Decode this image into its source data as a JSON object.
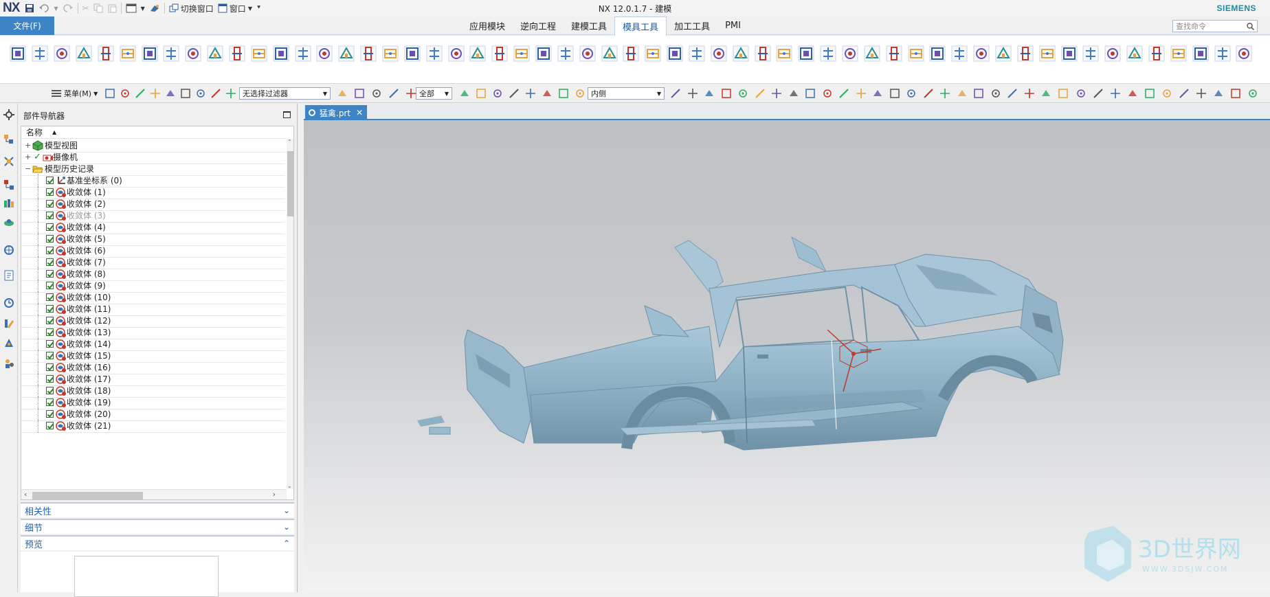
{
  "app": {
    "title": "NX 12.0.1.7 - 建模",
    "logo": "NX",
    "vendor": "SIEMENS"
  },
  "quickaccess": {
    "switch_window": "切换窗口",
    "window": "窗口"
  },
  "menubar": {
    "file": "文件(F)",
    "tabs": [
      "应用模块",
      "逆向工程",
      "建模工具",
      "模具工具",
      "加工工具",
      "PMI"
    ],
    "active_tab": "模具工具",
    "search_placeholder": "查找命令"
  },
  "selection_bar": {
    "menu": "菜单(M)",
    "filter": "无选择过滤器",
    "scope": "全部",
    "inside": "内侧"
  },
  "navigator": {
    "title": "部件导航器",
    "column_name": "名称",
    "top_nodes": [
      {
        "label": "模型视图"
      },
      {
        "label": "摄像机"
      },
      {
        "label": "模型历史记录"
      }
    ],
    "history": [
      {
        "label": "基准坐标系 (0)",
        "dim": false
      },
      {
        "label": "收敛体 (1)",
        "dim": false
      },
      {
        "label": "收敛体 (2)",
        "dim": false
      },
      {
        "label": "收敛体 (3)",
        "dim": true
      },
      {
        "label": "收敛体 (4)",
        "dim": false
      },
      {
        "label": "收敛体 (5)",
        "dim": false
      },
      {
        "label": "收敛体 (6)",
        "dim": false
      },
      {
        "label": "收敛体 (7)",
        "dim": false
      },
      {
        "label": "收敛体 (8)",
        "dim": false
      },
      {
        "label": "收敛体 (9)",
        "dim": false
      },
      {
        "label": "收敛体 (10)",
        "dim": false
      },
      {
        "label": "收敛体 (11)",
        "dim": false
      },
      {
        "label": "收敛体 (12)",
        "dim": false
      },
      {
        "label": "收敛体 (13)",
        "dim": false
      },
      {
        "label": "收敛体 (14)",
        "dim": false
      },
      {
        "label": "收敛体 (15)",
        "dim": false
      },
      {
        "label": "收敛体 (16)",
        "dim": false
      },
      {
        "label": "收敛体 (17)",
        "dim": false
      },
      {
        "label": "收敛体 (18)",
        "dim": false
      },
      {
        "label": "收敛体 (19)",
        "dim": false
      },
      {
        "label": "收敛体 (20)",
        "dim": false
      },
      {
        "label": "收敛体 (21)",
        "dim": false
      }
    ],
    "sections": {
      "dependencies": "相关性",
      "details": "细节",
      "preview": "预览"
    }
  },
  "document": {
    "tab": "猛禽.prt"
  },
  "watermark": {
    "brand": "3D世界网",
    "url": "WWW.3DSJW.COM"
  },
  "colors": {
    "accent": "#3d84c6",
    "model": "#8fb3c8",
    "brand": "#1e8aa3"
  }
}
